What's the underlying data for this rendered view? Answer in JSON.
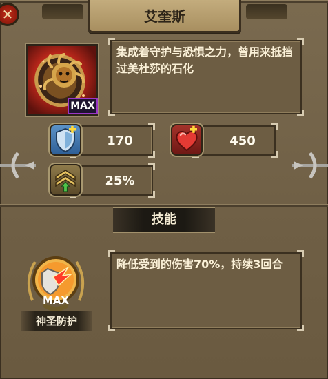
{
  "header": {
    "title": "艾奎斯"
  },
  "close_button": {
    "glyph": "✕"
  },
  "item": {
    "description": "集成着守护与恐惧之力，曾用来抵挡过美杜莎的石化",
    "grade_badge": "MAX",
    "icon": "medusa-shield-icon"
  },
  "stats": {
    "defense": {
      "icon": "shield-plus-icon",
      "value": "170"
    },
    "health": {
      "icon": "heart-plus-icon",
      "value": "450"
    },
    "boost": {
      "icon": "rank-up-chevrons-icon",
      "value": "25%"
    }
  },
  "skill_section": {
    "header": "技能",
    "skill": {
      "icon": "holy-shield-skill-icon",
      "level_text": "MAX",
      "name": "神圣防护",
      "description": "降低受到的伤害70%，持续3回合"
    }
  },
  "colors": {
    "panel_bg": "#6f5f45",
    "title_plate": "#b79f70",
    "text_light": "#fbf1d8",
    "max_border": "#9a37c7",
    "close_red": "#b3220f"
  }
}
